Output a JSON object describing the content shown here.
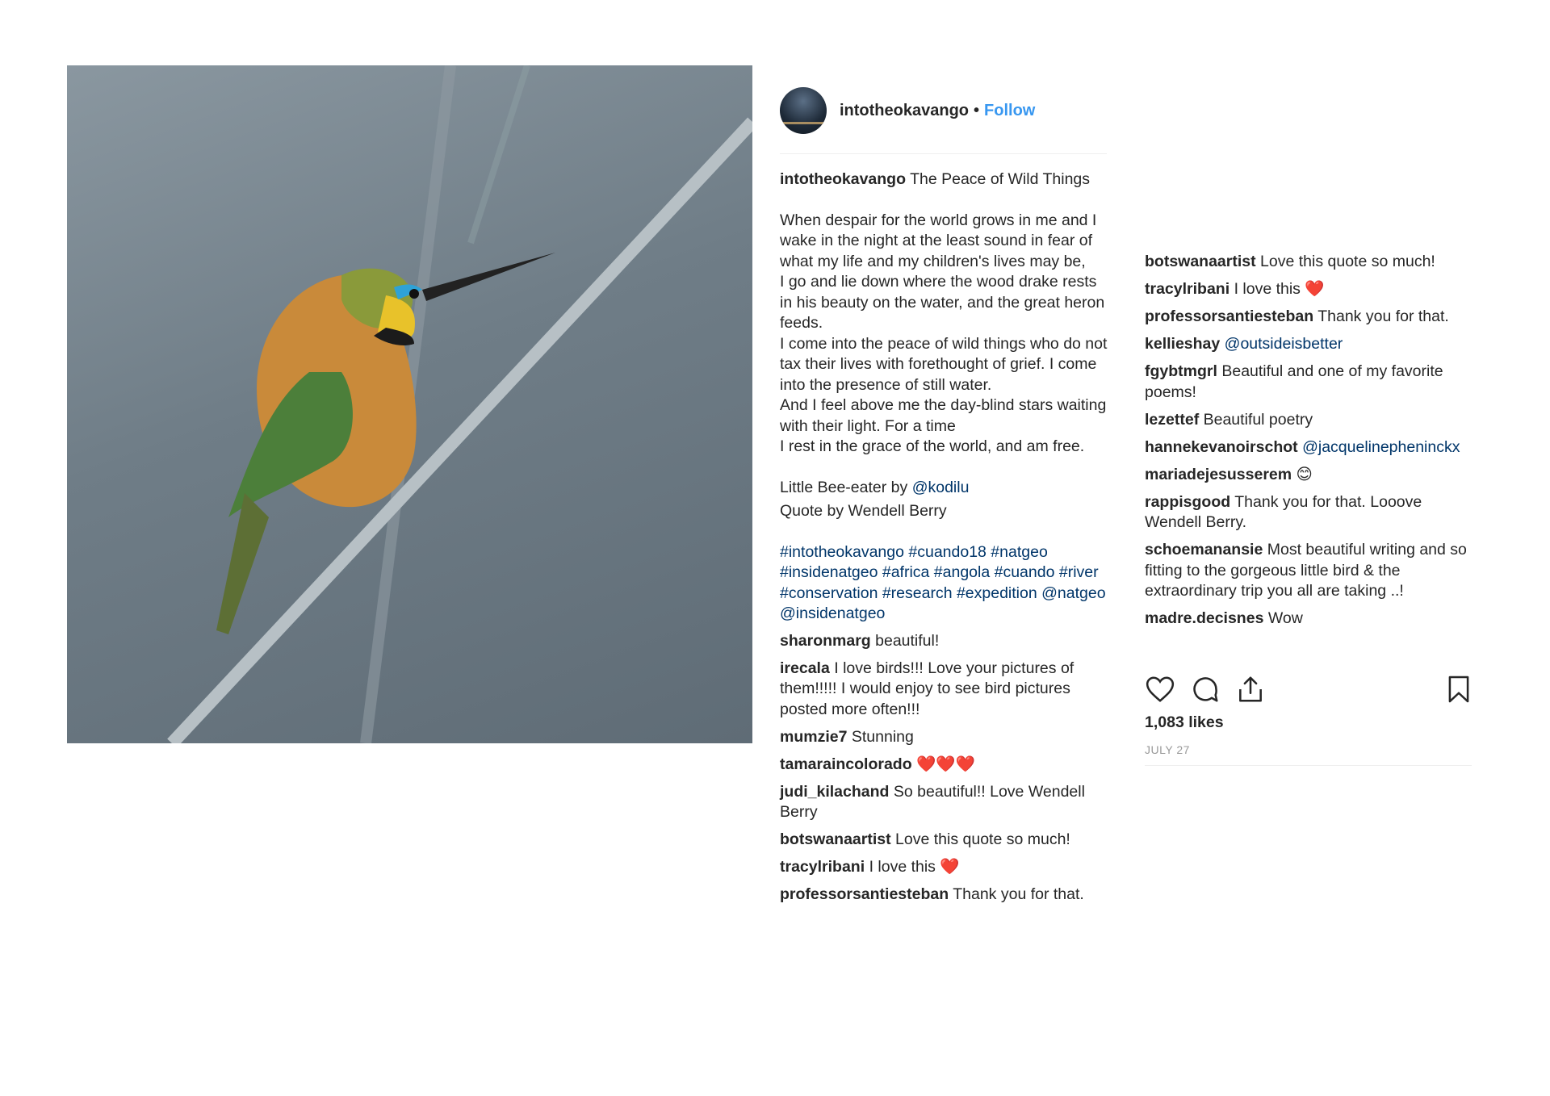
{
  "post": {
    "image_alt": "Little Bee-eater perched on a reed",
    "username": "intotheokavango",
    "separator": "•",
    "follow_label": "Follow",
    "caption": {
      "username": "intotheokavango",
      "title": "The Peace of Wild Things",
      "poem": [
        "When despair for the world grows in me and I wake in the night at the least sound in fear of what my life and my children's lives may be,",
        "I go and lie down where the wood drake rests in his beauty on the water, and the great heron feeds.",
        "I come into the peace of wild things who do not tax their lives with forethought of grief. I come into the presence of still water.",
        "And I feel above me the day-blind stars waiting with their light. For a time",
        "I rest in the grace of the world, and am free."
      ],
      "credit_prefix": "Little Bee-eater by ",
      "credit_mention": "@kodilu",
      "quote_credit": "Quote by Wendell Berry",
      "hashtags": "#intotheokavango #cuando18 #natgeo #insidenatgeo #africa #angola #cuando #river #conservation #research #expedition @natgeo @insidenatgeo"
    },
    "comments_left": [
      {
        "user": "sharonmarg",
        "text": "beautiful!"
      },
      {
        "user": "irecala",
        "text": "I love birds!!! Love your pictures of them!!!!! I would enjoy to see bird pictures posted more often!!!"
      },
      {
        "user": "mumzie7",
        "text": "Stunning"
      },
      {
        "user": "tamaraincolorado",
        "text": "❤️❤️❤️"
      },
      {
        "user": "judi_kilachand",
        "text": "So beautiful!! Love Wendell Berry"
      },
      {
        "user": "botswanaartist",
        "text": "Love this quote so much!"
      },
      {
        "user": "tracylribani",
        "text": "I love this ❤️"
      },
      {
        "user": "professorsantiesteban",
        "text": "Thank you for that."
      }
    ],
    "comments_right": [
      {
        "user": "botswanaartist",
        "text": "Love this quote so much!"
      },
      {
        "user": "tracylribani",
        "text": "I love this ❤️"
      },
      {
        "user": "professorsantiesteban",
        "text": "Thank you for that."
      },
      {
        "user": "kellieshay",
        "text": "@outsideisbetter",
        "is_mention": true
      },
      {
        "user": "fgybtmgrl",
        "text": "Beautiful and one of my favorite poems!"
      },
      {
        "user": "lezettef",
        "text": "Beautiful poetry"
      },
      {
        "user": "hannekevanoirschot",
        "text": "@jacquelinepheninckx",
        "is_mention": true
      },
      {
        "user": "mariadejesusserem",
        "text": "😊"
      },
      {
        "user": "rappisgood",
        "text": "Thank you for that. Looove Wendell Berry."
      },
      {
        "user": "schoemanansie",
        "text": "Most beautiful writing and so fitting to the gorgeous little bird & the extraordinary trip you all are taking ..!"
      },
      {
        "user": "madre.decisnes",
        "text": "Wow"
      }
    ],
    "actions": {
      "like_icon": "heart-icon",
      "comment_icon": "comment-icon",
      "share_icon": "share-icon",
      "save_icon": "bookmark-icon"
    },
    "likes": "1,083 likes",
    "date": "JULY 27",
    "colors": {
      "link": "#003569",
      "follow": "#3897f0",
      "text": "#262626",
      "muted": "#999999"
    }
  }
}
